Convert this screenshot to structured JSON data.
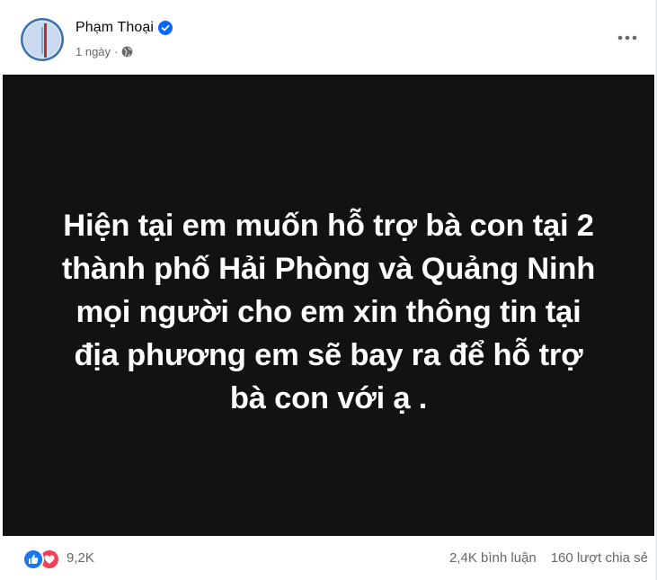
{
  "post": {
    "author_name": "Phạm Thoại",
    "timestamp": "1 ngày",
    "separator": "·",
    "privacy_icon": "globe-icon",
    "more_icon": "more-options-icon",
    "verified_icon": "verified-badge-icon",
    "image_text_lines": [
      "Hiện tại em muốn hỗ trợ bà con tại 2",
      "thành phố Hải Phòng và Quảng Ninh",
      "mọi người cho em xin thông tin tại",
      "địa phương em sẽ bay ra để hỗ trợ",
      "bà con với ạ ."
    ]
  },
  "stats": {
    "reaction_icons": [
      "like-icon",
      "love-icon"
    ],
    "reaction_count": "9,2K",
    "comments": "2,4K bình luận",
    "shares": "160 lượt chia sẻ"
  },
  "colors": {
    "verified_blue": "#0866ff",
    "like_blue": "#1877f2",
    "love_red": "#f33e58",
    "secondary_text": "#65676b",
    "image_background": "#121212"
  }
}
